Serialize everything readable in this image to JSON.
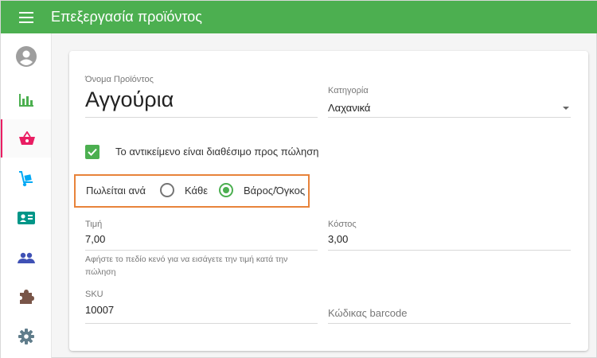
{
  "appbar": {
    "title": "Επεξεργασία προϊόντος",
    "menu_icon": "menu-icon",
    "color": "#4caf50"
  },
  "sidebar": {
    "items": [
      {
        "icon": "account-circle-icon",
        "color": "#9e9e9e"
      },
      {
        "icon": "bar-chart-icon",
        "color": "#4caf50"
      },
      {
        "icon": "shopping-basket-icon",
        "color": "#e91e63",
        "active": true
      },
      {
        "icon": "hand-truck-icon",
        "color": "#03a9f4"
      },
      {
        "icon": "contact-card-icon",
        "color": "#009688"
      },
      {
        "icon": "people-icon",
        "color": "#3f51b5"
      },
      {
        "icon": "puzzle-icon",
        "color": "#795548"
      },
      {
        "icon": "settings-icon",
        "color": "#607d8b"
      }
    ]
  },
  "form": {
    "name": {
      "label": "Όνομα Προϊόντος",
      "value": "Αγγούρια"
    },
    "category": {
      "label": "Κατηγορία",
      "value": "Λαχανικά"
    },
    "available": {
      "label": "Το αντικείμενο είναι διαθέσιμο προς πώληση",
      "checked": true
    },
    "sold_by": {
      "label": "Πωλείται ανά",
      "options": [
        "Κάθε",
        "Βάρος/Όγκος"
      ],
      "selected": "Βάρος/Όγκος"
    },
    "price": {
      "label": "Τιμή",
      "value": "7,00",
      "hint": "Αφήστε το πεδίο κενό για να εισάγετε την τιμή κατά την πώληση"
    },
    "cost": {
      "label": "Κόστος",
      "value": "3,00"
    },
    "sku": {
      "label": "SKU",
      "value": "10007"
    },
    "barcode": {
      "placeholder": "Κώδικας barcode"
    }
  },
  "colors": {
    "accent": "#4caf50",
    "highlight_border": "#e8833a"
  }
}
